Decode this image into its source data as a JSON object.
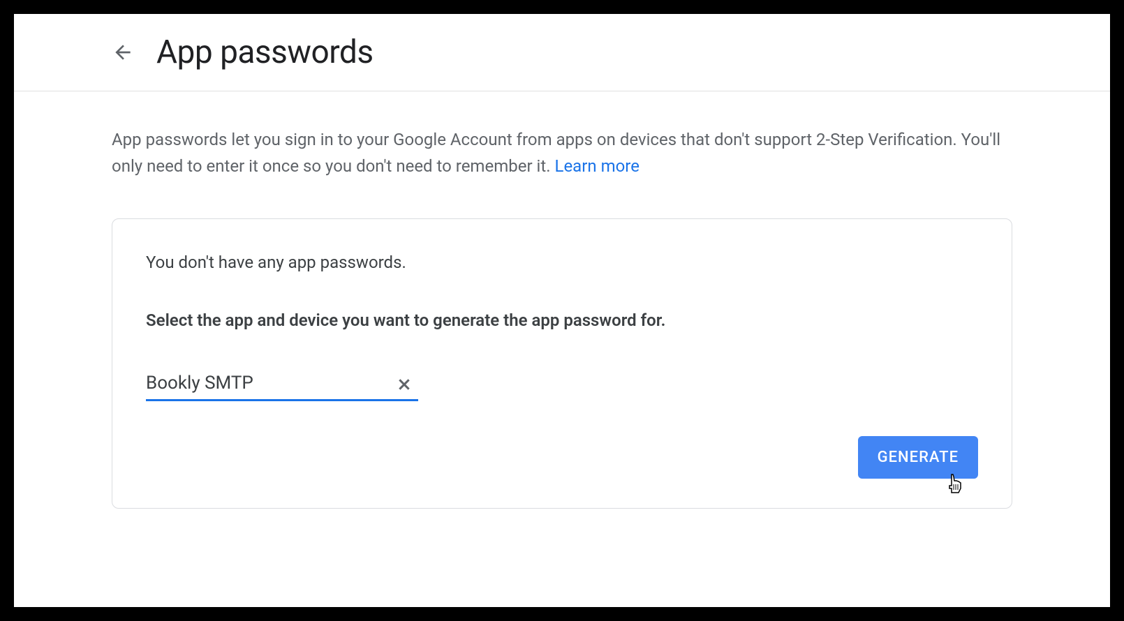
{
  "header": {
    "title": "App passwords"
  },
  "description": {
    "text": "App passwords let you sign in to your Google Account from apps on devices that don't support 2-Step Verification. You'll only need to enter it once so you don't need to remember it. ",
    "learn_more": "Learn more"
  },
  "card": {
    "no_passwords": "You don't have any app passwords.",
    "select_prompt": "Select the app and device you want to generate the app password for.",
    "input_value": "Bookly SMTP",
    "generate_button": "GENERATE"
  }
}
